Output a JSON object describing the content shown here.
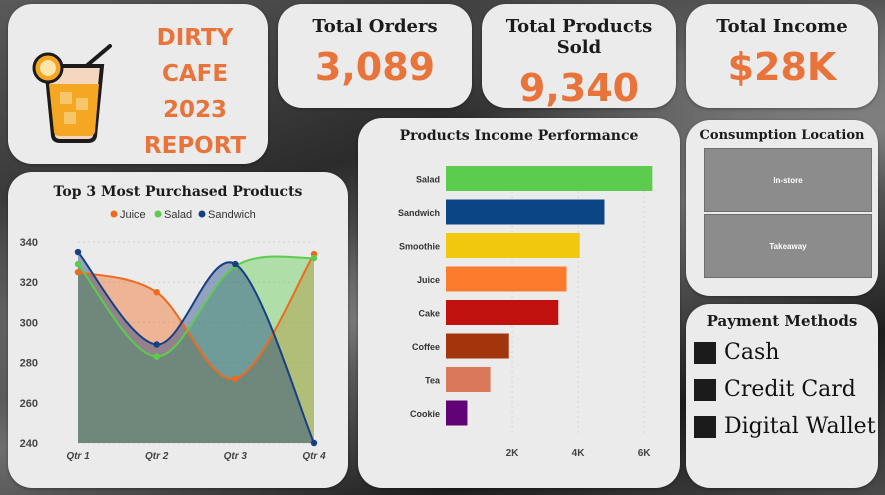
{
  "report": {
    "lines": [
      "DIRTY",
      "CAFE",
      "2023",
      "REPORT"
    ],
    "accent_color": "#e8743b",
    "logo_icon": "iced-drink-icon"
  },
  "kpis": [
    {
      "title": "Total Orders",
      "value": "3,089"
    },
    {
      "title": "Total Products Sold",
      "value": "9,340"
    },
    {
      "title": "Total Income",
      "value": "$28K"
    }
  ],
  "consumption": {
    "title": "Consumption Location",
    "locations": [
      "In-store",
      "Takeaway"
    ]
  },
  "payment": {
    "title": "Payment Methods",
    "methods": [
      "Cash",
      "Credit Card",
      "Digital Wallet"
    ]
  },
  "chart_data": [
    {
      "type": "area",
      "title": "Top 3 Most Purchased Products",
      "categories": [
        "Qtr 1",
        "Qtr 2",
        "Qtr 3",
        "Qtr 4"
      ],
      "ylim": [
        240,
        340
      ],
      "yticks": [
        240,
        260,
        280,
        300,
        320,
        340
      ],
      "legend_position": "top",
      "series": [
        {
          "name": "Juice",
          "color": "#f06a1e",
          "values": [
            325,
            315,
            272,
            334
          ]
        },
        {
          "name": "Salad",
          "color": "#5ccc4f",
          "values": [
            329,
            283,
            328,
            332
          ]
        },
        {
          "name": "Sandwich",
          "color": "#173f84",
          "values": [
            335,
            289,
            329,
            240
          ]
        }
      ]
    },
    {
      "type": "bar",
      "orientation": "horizontal",
      "title": "Products Income Performance",
      "categories": [
        "Salad",
        "Sandwich",
        "Smoothie",
        "Juice",
        "Cake",
        "Coffee",
        "Tea",
        "Cookie"
      ],
      "values": [
        6250,
        4800,
        4050,
        3650,
        3400,
        1900,
        1350,
        650
      ],
      "colors": [
        "#5ccc4f",
        "#0b4586",
        "#f2c80f",
        "#fd7b2c",
        "#c0110f",
        "#a2350b",
        "#d9795a",
        "#610377"
      ],
      "xticks": [
        2000,
        4000,
        6000
      ],
      "xtick_labels": [
        "2K",
        "4K",
        "6K"
      ],
      "xlim": [
        0,
        6300
      ]
    }
  ]
}
